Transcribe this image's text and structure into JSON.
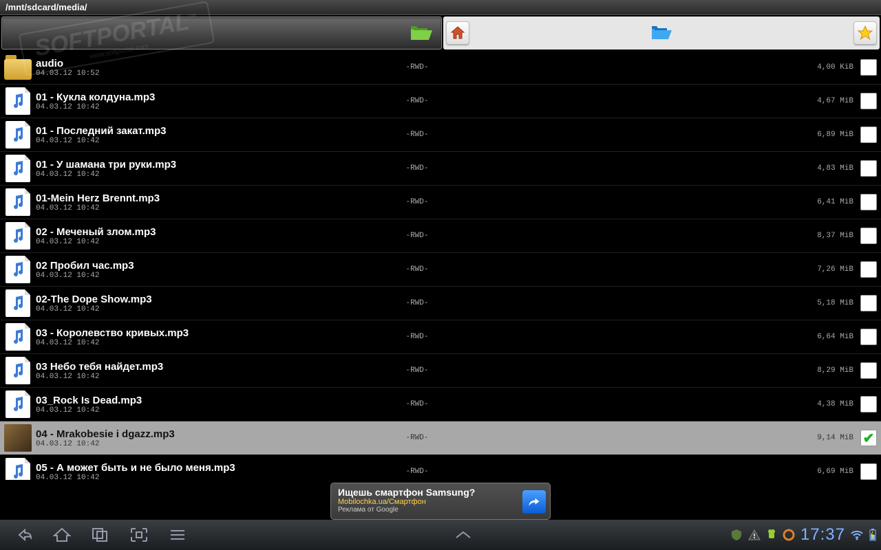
{
  "path": "/mnt/sdcard/media/",
  "watermark": {
    "text": "SOFTPORTAL",
    "tm": "™",
    "url": "www.softportal.com"
  },
  "files": [
    {
      "name": "audio",
      "date": "04.03.12 10:52",
      "perm": "-RWD-",
      "size": "4,00 KiB",
      "type": "folder",
      "checked": false
    },
    {
      "name": "01 - Кукла колдуна.mp3",
      "date": "04.03.12 10:42",
      "perm": "-RWD-",
      "size": "4,67 MiB",
      "type": "music",
      "checked": false
    },
    {
      "name": "01 - Последний закат.mp3",
      "date": "04.03.12 10:42",
      "perm": "-RWD-",
      "size": "6,89 MiB",
      "type": "music",
      "checked": false
    },
    {
      "name": "01 - У шамана три руки.mp3",
      "date": "04.03.12 10:42",
      "perm": "-RWD-",
      "size": "4,83 MiB",
      "type": "music",
      "checked": false
    },
    {
      "name": "01-Mein Herz Brennt.mp3",
      "date": "04.03.12 10:42",
      "perm": "-RWD-",
      "size": "6,41 MiB",
      "type": "music",
      "checked": false
    },
    {
      "name": "02 - Меченый злом.mp3",
      "date": "04.03.12 10:42",
      "perm": "-RWD-",
      "size": "8,37 MiB",
      "type": "music",
      "checked": false
    },
    {
      "name": "02 Пробил час.mp3",
      "date": "04.03.12 10:42",
      "perm": "-RWD-",
      "size": "7,26 MiB",
      "type": "music",
      "checked": false
    },
    {
      "name": "02-The Dope Show.mp3",
      "date": "04.03.12 10:42",
      "perm": "-RWD-",
      "size": "5,18 MiB",
      "type": "music",
      "checked": false
    },
    {
      "name": "03 - Королевство кривых.mp3",
      "date": "04.03.12 10:42",
      "perm": "-RWD-",
      "size": "6,64 MiB",
      "type": "music",
      "checked": false
    },
    {
      "name": "03 Небо тебя найдет.mp3",
      "date": "04.03.12 10:42",
      "perm": "-RWD-",
      "size": "8,29 MiB",
      "type": "music",
      "checked": false
    },
    {
      "name": "03_Rock Is Dead.mp3",
      "date": "04.03.12 10:42",
      "perm": "-RWD-",
      "size": "4,38 MiB",
      "type": "music",
      "checked": false
    },
    {
      "name": "04 - Mrakobesie i dgazz.mp3",
      "date": "04.03.12 10:42",
      "perm": "-RWD-",
      "size": "9,14 MiB",
      "type": "album",
      "checked": true
    },
    {
      "name": "05 - А может быть и не было меня.mp3",
      "date": "04.03.12 10:42",
      "perm": "-RWD-",
      "size": "6,69 MiB",
      "type": "music",
      "checked": false
    }
  ],
  "ad": {
    "line1": "Ищешь смартфон Samsung?",
    "line2": "Mobilochka.ua/Смартфон",
    "line3": "Реклама от Google"
  },
  "clock": "17:37"
}
